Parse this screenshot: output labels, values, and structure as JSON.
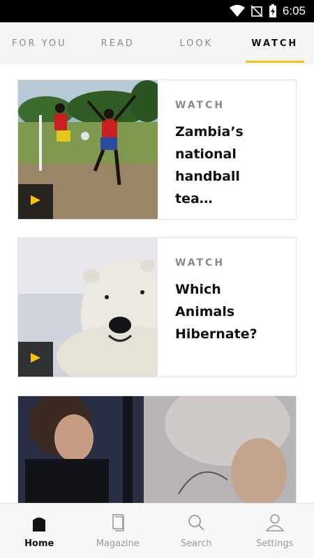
{
  "status_bar": {
    "time": "6:05"
  },
  "tabs": [
    {
      "label": "FOR YOU",
      "active": false
    },
    {
      "label": "READ",
      "active": false
    },
    {
      "label": "LOOK",
      "active": false
    },
    {
      "label": "WATCH",
      "active": true
    }
  ],
  "feed": [
    {
      "kicker": "WATCH",
      "title_line1": "Zambia’s",
      "title_line2": "national",
      "title_line3": "handball tea…"
    },
    {
      "kicker": "WATCH",
      "title_line1": "Which Animals",
      "title_line2": "Hibernate?"
    }
  ],
  "nav": [
    {
      "label": "Home",
      "icon": "home-icon",
      "active": true
    },
    {
      "label": "Magazine",
      "icon": "magazine-icon",
      "active": false
    },
    {
      "label": "Search",
      "icon": "search-icon",
      "active": false
    },
    {
      "label": "Settings",
      "icon": "person-icon",
      "active": false
    }
  ],
  "colors": {
    "accent": "#f6c30e"
  }
}
